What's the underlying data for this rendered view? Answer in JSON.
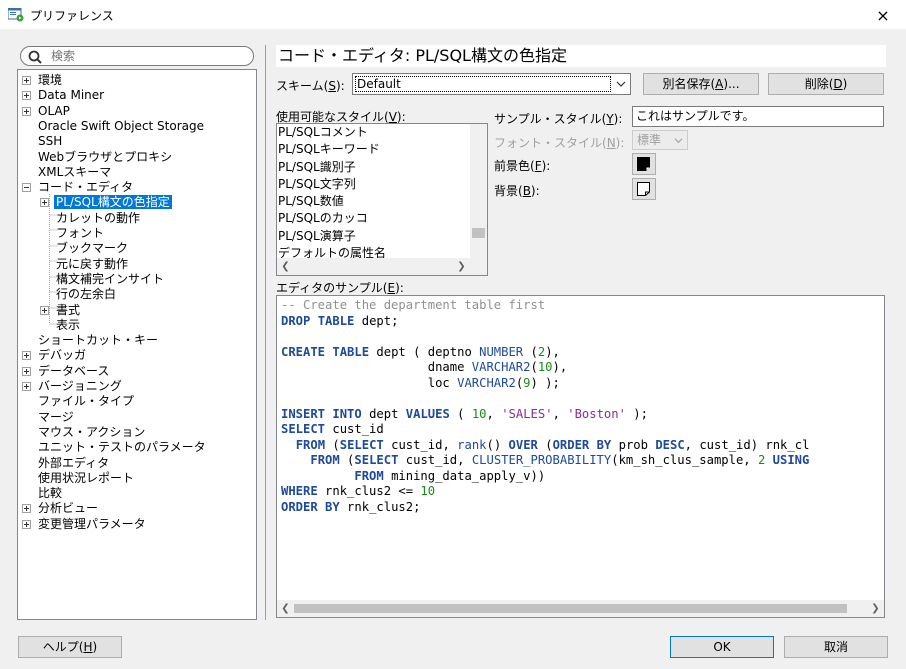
{
  "window": {
    "title": "プリファレンス",
    "close_icon": "×"
  },
  "search": {
    "placeholder": "検索"
  },
  "tree": {
    "items": [
      {
        "label": "環境",
        "expander": "plus"
      },
      {
        "label": "Data Miner",
        "expander": "plus"
      },
      {
        "label": "OLAP",
        "expander": "plus"
      },
      {
        "label": "Oracle Swift Object Storage",
        "expander": ""
      },
      {
        "label": "SSH",
        "expander": ""
      },
      {
        "label": "Webブラウザとプロキシ",
        "expander": ""
      },
      {
        "label": "XMLスキーマ",
        "expander": ""
      },
      {
        "label": "コード・エディタ",
        "expander": "minus"
      },
      {
        "label": "PL/SQL構文の色指定",
        "expander": "plus",
        "selected": true
      },
      {
        "label": "カレットの動作",
        "expander": ""
      },
      {
        "label": "フォント",
        "expander": ""
      },
      {
        "label": "ブックマーク",
        "expander": ""
      },
      {
        "label": "元に戻す動作",
        "expander": ""
      },
      {
        "label": "構文補完インサイト",
        "expander": ""
      },
      {
        "label": "行の左余白",
        "expander": ""
      },
      {
        "label": "書式",
        "expander": "plus"
      },
      {
        "label": "表示",
        "expander": ""
      },
      {
        "label": "ショートカット・キー",
        "expander": ""
      },
      {
        "label": "デバッガ",
        "expander": "plus"
      },
      {
        "label": "データベース",
        "expander": "plus"
      },
      {
        "label": "バージョニング",
        "expander": "plus"
      },
      {
        "label": "ファイル・タイプ",
        "expander": ""
      },
      {
        "label": "マージ",
        "expander": ""
      },
      {
        "label": "マウス・アクション",
        "expander": ""
      },
      {
        "label": "ユニット・テストのパラメータ",
        "expander": ""
      },
      {
        "label": "外部エディタ",
        "expander": ""
      },
      {
        "label": "使用状況レポート",
        "expander": ""
      },
      {
        "label": "比較",
        "expander": ""
      },
      {
        "label": "分析ビュー",
        "expander": "plus"
      },
      {
        "label": "変更管理パラメータ",
        "expander": "plus"
      }
    ]
  },
  "panel": {
    "title": "コード・エディタ: PL/SQL構文の色指定",
    "scheme_label": "スキーム(",
    "scheme_key": "S",
    "scheme_label_end": "):",
    "scheme_value": "Default",
    "save_as_label": "別名保存(",
    "save_as_key": "A",
    "save_as_end": ")...",
    "delete_label": "削除(",
    "delete_key": "D",
    "delete_end": ")",
    "styles_label": "使用可能なスタイル(",
    "styles_key": "V",
    "styles_end": "):",
    "styles": [
      "PL/SQLコメント",
      "PL/SQLキーワード",
      "PL/SQL識別子",
      "PL/SQL文字列",
      "PL/SQL数値",
      "PL/SQLのカッコ",
      "PL/SQL演算子",
      "デフォルトの属性名"
    ],
    "sample_style_label": "サンプル・スタイル(",
    "sample_style_key": "Y",
    "sample_style_end": "):",
    "sample_style_value": "これはサンプルです。",
    "font_style_label": "フォント・スタイル(",
    "font_style_key": "N",
    "font_style_end": "):",
    "font_style_value": "標準",
    "fg_label": "前景色(",
    "fg_key": "F",
    "fg_end": "):",
    "bg_label": "背景(",
    "bg_key": "B",
    "bg_end": "):",
    "editor_sample_label": "エディタのサンプル(",
    "editor_sample_key": "E",
    "editor_sample_end": "):"
  },
  "code_sample": {
    "comment": "-- Create the department table first",
    "lines": [
      "DROP TABLE dept;",
      "CREATE TABLE dept ( deptno NUMBER (2),",
      "dname VARCHAR2(10),",
      "loc VARCHAR2(9) );",
      "INSERT INTO dept VALUES ( 10, 'SALES', 'Boston' );",
      "SELECT cust_id",
      "FROM (SELECT cust_id, rank() OVER (ORDER BY prob DESC, cust_id) rnk_cl",
      "FROM (SELECT cust_id, CLUSTER_PROBABILITY(km_sh_clus_sample, 2 USING",
      "FROM mining_data_apply_v))",
      "WHERE rnk_clus2 <= 10",
      "ORDER BY rnk_clus2;"
    ]
  },
  "footer": {
    "help_label": "ヘルプ(",
    "help_key": "H",
    "help_end": ")",
    "ok_label": "OK",
    "cancel_label": "取消"
  },
  "colors": {
    "selection": "#0078d7",
    "keyword": "#1d4a9a",
    "number": "#1a8a1a",
    "string": "#8a2aa0",
    "comment": "#909090"
  }
}
